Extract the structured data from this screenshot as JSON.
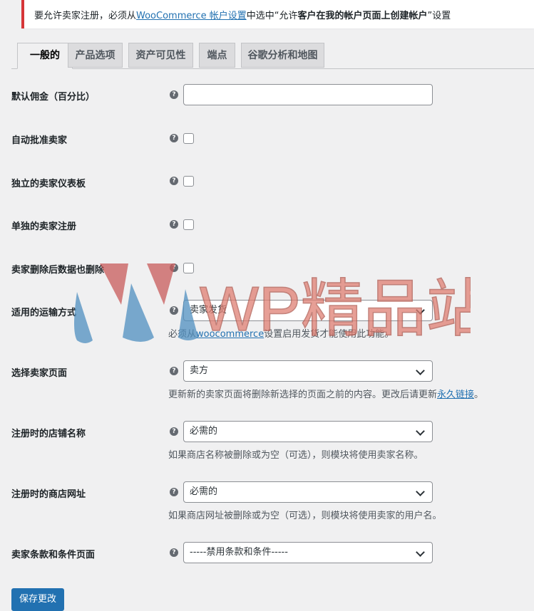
{
  "notice": {
    "prefix": "要允许卖家注册，必须从",
    "link": "WooCommerce 帐户设置",
    "middle": "中选中“允许",
    "bold": "客户在我的帐户页面上创建帐户",
    "suffix": "”设置"
  },
  "tabs": [
    "一般的",
    "产品选项",
    "资产可见性",
    "端点",
    "谷歌分析和地图"
  ],
  "help_glyph": "?",
  "fields": {
    "commission": {
      "label": "默认佣金（百分比）",
      "value": ""
    },
    "auto_approve": {
      "label": "自动批准卖家"
    },
    "separate_dashboard": {
      "label": "独立的卖家仪表板"
    },
    "separate_registration": {
      "label": "单独的卖家注册"
    },
    "delete_data": {
      "label": "卖家删除后数据也删除"
    },
    "shipping": {
      "label": "适用的运输方式",
      "value": "卖家发货",
      "desc_prefix": "必须从",
      "desc_link": "woocommerce",
      "desc_suffix": "设置启用发货才能使用此功能。"
    },
    "vendor_page": {
      "label": "选择卖家页面",
      "value": "卖方",
      "desc_prefix": "更新新的卖家页面将删除新选择的页面之前的内容。更改后请更新",
      "desc_link": "永久链接",
      "desc_suffix": "。"
    },
    "store_name": {
      "label": "注册时的店铺名称",
      "value": "必需的",
      "desc": "如果商店名称被删除或为空（可选），则模块将使用卖家名称。"
    },
    "store_url": {
      "label": "注册时的商店网址",
      "value": "必需的",
      "desc": "如果商店网址被删除或为空（可选），则模块将使用卖家的用户名。"
    },
    "terms_page": {
      "label": "卖家条款和条件页面",
      "value": "-----禁用条款和条件-----"
    }
  },
  "save_label": "保存更改",
  "watermark": {
    "text": "WP精品站"
  },
  "colors": {
    "accent": "#2271b1",
    "notice_border": "#d63638",
    "watermark_text": "#e07f73",
    "watermark_blue": "#4f8fc0",
    "watermark_red": "#c95b5b"
  }
}
